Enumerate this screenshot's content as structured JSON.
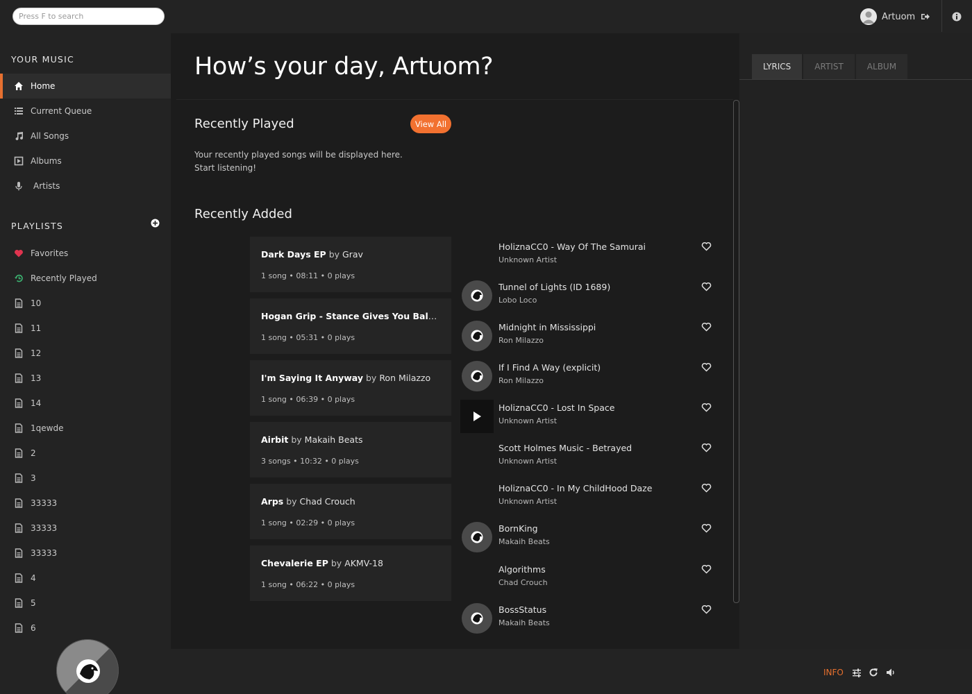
{
  "search": {
    "placeholder": "Press F to search"
  },
  "user": {
    "name": "Artuom"
  },
  "sidebar": {
    "your_music_title": "YOUR MUSIC",
    "items": [
      {
        "label": "Home",
        "icon": "home-icon",
        "active": true
      },
      {
        "label": "Current Queue",
        "icon": "queue-icon"
      },
      {
        "label": "All Songs",
        "icon": "music-note-icon"
      },
      {
        "label": "Albums",
        "icon": "album-icon"
      },
      {
        "label": "Artists",
        "icon": "microphone-icon"
      }
    ],
    "playlists_title": "PLAYLISTS",
    "playlists": [
      {
        "label": "Favorites",
        "icon": "heart-icon",
        "color": "#e0344f"
      },
      {
        "label": "Recently Played",
        "icon": "history-icon",
        "color": "#3cb371"
      },
      {
        "label": "10",
        "icon": "file-icon"
      },
      {
        "label": "11",
        "icon": "file-icon"
      },
      {
        "label": "12",
        "icon": "file-icon"
      },
      {
        "label": "13",
        "icon": "file-icon"
      },
      {
        "label": "14",
        "icon": "file-icon"
      },
      {
        "label": "1qewde",
        "icon": "file-icon"
      },
      {
        "label": "2",
        "icon": "file-icon"
      },
      {
        "label": "3",
        "icon": "file-icon"
      },
      {
        "label": "33333",
        "icon": "file-icon"
      },
      {
        "label": "33333",
        "icon": "file-icon"
      },
      {
        "label": "33333",
        "icon": "file-icon"
      },
      {
        "label": "4",
        "icon": "file-icon"
      },
      {
        "label": "5",
        "icon": "file-icon"
      },
      {
        "label": "6",
        "icon": "file-icon"
      }
    ]
  },
  "main": {
    "greeting": "How’s your day, Artuom?",
    "recently_played": {
      "title": "Recently Played",
      "view_all": "View All",
      "hint_line1": "Your recently played songs will be displayed here.",
      "hint_line2": "Start listening!"
    },
    "recently_added": {
      "title": "Recently Added",
      "albums": [
        {
          "title": "Dark Days EP",
          "by": "by",
          "artist": "Grav",
          "meta": "1 song • 08:11 • 0 plays"
        },
        {
          "title": "Hogan Grip - Stance Gives You Balance",
          "by": "by…",
          "artist": "",
          "meta": "1 song • 05:31 • 0 plays"
        },
        {
          "title": "I'm Saying It Anyway",
          "by": "by",
          "artist": "Ron Milazzo",
          "meta": "1 song • 06:39 • 0 plays"
        },
        {
          "title": "Airbit",
          "by": "by",
          "artist": "Makaih Beats",
          "meta": "3 songs • 10:32 • 0 plays"
        },
        {
          "title": "Arps",
          "by": "by",
          "artist": "Chad Crouch",
          "meta": "1 song • 02:29 • 0 plays"
        },
        {
          "title": "Chevalerie EP",
          "by": "by",
          "artist": "AKMV-18",
          "meta": "1 song • 06:22 • 0 plays"
        }
      ],
      "songs": [
        {
          "title": "HoliznaCC0 - Way Of The Samurai",
          "artist": "Unknown Artist",
          "thumb": "none"
        },
        {
          "title": "Tunnel of Lights (ID 1689)",
          "artist": "Lobo Loco",
          "thumb": "disc"
        },
        {
          "title": "Midnight in Mississippi",
          "artist": "Ron Milazzo",
          "thumb": "disc"
        },
        {
          "title": "If I Find A Way (explicit)",
          "artist": "Ron Milazzo",
          "thumb": "disc"
        },
        {
          "title": "HoliznaCC0 - Lost In Space",
          "artist": "Unknown Artist",
          "thumb": "play"
        },
        {
          "title": "Scott Holmes Music - Betrayed",
          "artist": "Unknown Artist",
          "thumb": "none"
        },
        {
          "title": "HoliznaCC0 - In My ChildHood Daze",
          "artist": "Unknown Artist",
          "thumb": "none"
        },
        {
          "title": "BornKing",
          "artist": "Makaih Beats",
          "thumb": "disc"
        },
        {
          "title": "Algorithms",
          "artist": "Chad Crouch",
          "thumb": "none"
        },
        {
          "title": "BossStatus",
          "artist": "Makaih Beats",
          "thumb": "disc"
        }
      ]
    }
  },
  "right_panel": {
    "tabs": [
      {
        "label": "LYRICS",
        "active": true
      },
      {
        "label": "ARTIST"
      },
      {
        "label": "ALBUM"
      }
    ]
  },
  "player": {
    "info_label": "INFO",
    "icons": [
      "equalizer-icon",
      "repeat-icon",
      "volume-icon"
    ],
    "accent": "#e8702e"
  },
  "colors": {
    "accent": "#f27130",
    "background": "#232323",
    "main_bg": "#1c1c1c"
  }
}
